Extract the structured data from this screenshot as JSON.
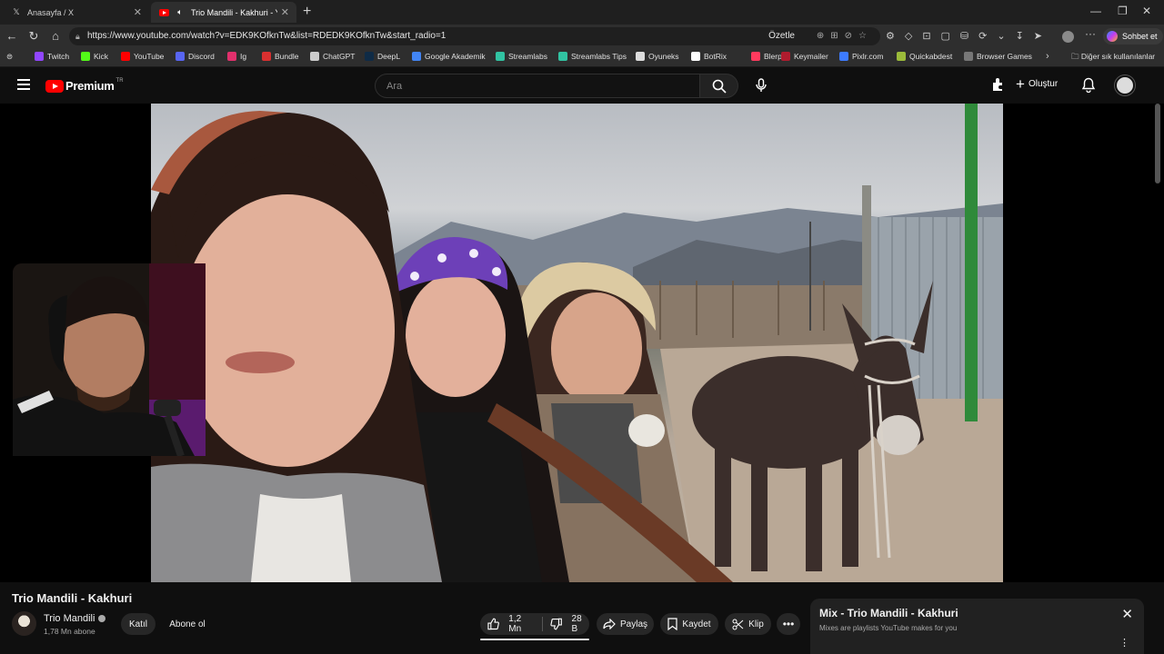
{
  "browser": {
    "tabs": [
      {
        "title": "Anasayfa / X",
        "icon": "x-logo-icon"
      },
      {
        "title": "Trio Mandili - Kakhuri - YouTu",
        "icon": "youtube-icon"
      }
    ],
    "url": "https://www.youtube.com/watch?v=EDK9KOfknTw&list=RDEDK9KOfknTw&start_radio=1",
    "summarize_label": "Özetle",
    "copilot_label": "Sohbet et",
    "bookmarks": [
      {
        "label": "Twitch",
        "color": "#9146ff"
      },
      {
        "label": "Kick",
        "color": "#53fc18"
      },
      {
        "label": "YouTube",
        "color": "#ff0000"
      },
      {
        "label": "Discord",
        "color": "#5865f2"
      },
      {
        "label": "Ig",
        "color": "#e1306c"
      },
      {
        "label": "Bundle",
        "color": "#d93030"
      },
      {
        "label": "ChatGPT",
        "color": "#cccccc"
      },
      {
        "label": "DeepL",
        "color": "#0f2b46"
      },
      {
        "label": "Google Akademik",
        "color": "#4285f4"
      },
      {
        "label": "Streamlabs",
        "color": "#31c3a2"
      },
      {
        "label": "Streamlabs Tips",
        "color": "#31c3a2"
      },
      {
        "label": "Oyuneks",
        "color": "#dddddd"
      },
      {
        "label": "BotRix",
        "color": "#ffffff"
      },
      {
        "label": "Blerp",
        "color": "#ff3a5e"
      },
      {
        "label": "Keymailer",
        "color": "#b01c2e"
      },
      {
        "label": "Pixlr.com",
        "color": "#3d7bff"
      },
      {
        "label": "Quickabdest",
        "color": "#9bbb3a"
      },
      {
        "label": "Browser Games",
        "color": "#777777"
      }
    ],
    "other_bookmarks": "Diğer sık kullanılanlar"
  },
  "youtube": {
    "brand": "Premium",
    "region": "TR",
    "search_placeholder": "Ara",
    "create_label": "Oluştur",
    "accent": "#ff0000"
  },
  "video": {
    "title": "Trio Mandili - Kakhuri",
    "channel": "Trio Mandili",
    "subscribers": "1,78 Mn abone",
    "join_label": "Katıl",
    "subscribe_label": "Abone ol",
    "likes": "1,2 Mn",
    "dislikes": "28 B",
    "share_label": "Paylaş",
    "save_label": "Kaydet",
    "clip_label": "Klip"
  },
  "mix": {
    "title": "Mix - Trio Mandili - Kakhuri",
    "subtitle": "Mixes are playlists YouTube makes for you"
  }
}
